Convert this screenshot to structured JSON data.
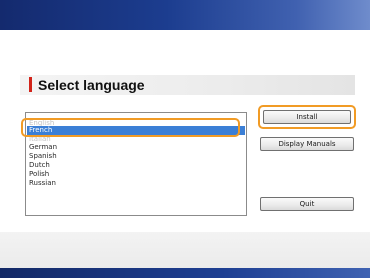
{
  "window": {
    "heading": "Select language"
  },
  "language_list": {
    "items": [
      {
        "label": "English",
        "state": "faded"
      },
      {
        "label": "French",
        "state": "selected"
      },
      {
        "label": "Italian",
        "state": "faded"
      },
      {
        "label": "German",
        "state": "normal"
      },
      {
        "label": "Spanish",
        "state": "normal"
      },
      {
        "label": "Dutch",
        "state": "normal"
      },
      {
        "label": "Polish",
        "state": "normal"
      },
      {
        "label": "Russian",
        "state": "normal"
      }
    ],
    "selected": "French"
  },
  "buttons": {
    "install": "Install",
    "display_manuals": "Display Manuals",
    "quit": "Quit"
  },
  "colors": {
    "accent_bar": "#d2241a",
    "highlight_ring": "#f19b25",
    "selection": "#3b7fd6",
    "header_blue": "#1c3d8f"
  }
}
